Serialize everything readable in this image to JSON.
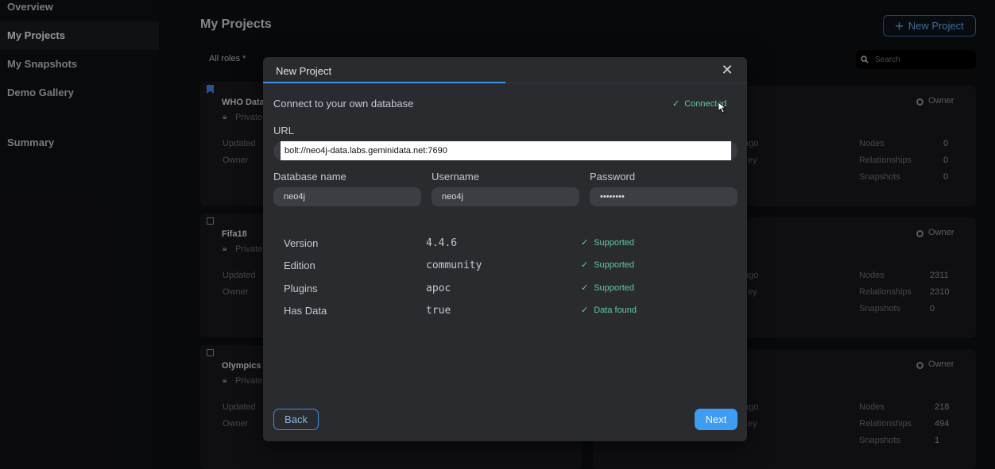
{
  "sidebar": {
    "items": [
      {
        "label": "Overview"
      },
      {
        "label": "My Projects"
      },
      {
        "label": "My Snapshots"
      },
      {
        "label": "Demo Gallery"
      },
      {
        "label": "Summary"
      }
    ]
  },
  "header": {
    "title": "My Projects",
    "new_project_label": "New Project",
    "filter_roles": "All roles",
    "search_placeholder": "Search"
  },
  "background_cards": [
    {
      "name": "WHO Data",
      "visibility": "Private",
      "updated_label": "Updated",
      "owner_label": "Owner",
      "role": "Owner",
      "updated_tail": "ago",
      "owner_tail": "ey",
      "nodes": "0",
      "relationships": "0",
      "snapshots": "0"
    },
    {
      "name": "Fifa18",
      "visibility": "Private",
      "updated_label": "Updated",
      "owner_label": "Owner",
      "role": "Owner",
      "updated_tail": "ago",
      "owner_tail": "ey",
      "nodes": "2311",
      "relationships": "2310",
      "snapshots": "0"
    },
    {
      "name": "Olympics I",
      "visibility": "Private",
      "updated_label": "Updated",
      "owner_label": "Owner",
      "role": "Owner",
      "updated_tail": "ago",
      "owner_tail": "ey",
      "nodes": "218",
      "relationships": "494",
      "snapshots": "1"
    }
  ],
  "stat_labels": {
    "nodes": "Nodes",
    "relationships": "Relationships",
    "snapshots": "Snapshots"
  },
  "modal": {
    "title": "New Project",
    "connect_label": "Connect to your own database",
    "status": "Connected",
    "url_label": "URL",
    "url_value": "bolt://neo4j-data.labs.geminidata.net:7690",
    "db_name_label": "Database name",
    "db_name_value": "neo4j",
    "username_label": "Username",
    "username_value": "neo4j",
    "password_label": "Password",
    "password_value": "••••••••",
    "info": [
      {
        "key": "Version",
        "value": "4.4.6",
        "status": "Supported"
      },
      {
        "key": "Edition",
        "value": "community",
        "status": "Supported"
      },
      {
        "key": "Plugins",
        "value": "apoc",
        "status": "Supported"
      },
      {
        "key": "Has Data",
        "value": "true",
        "status": "Data found"
      }
    ],
    "back_label": "Back",
    "next_label": "Next"
  }
}
